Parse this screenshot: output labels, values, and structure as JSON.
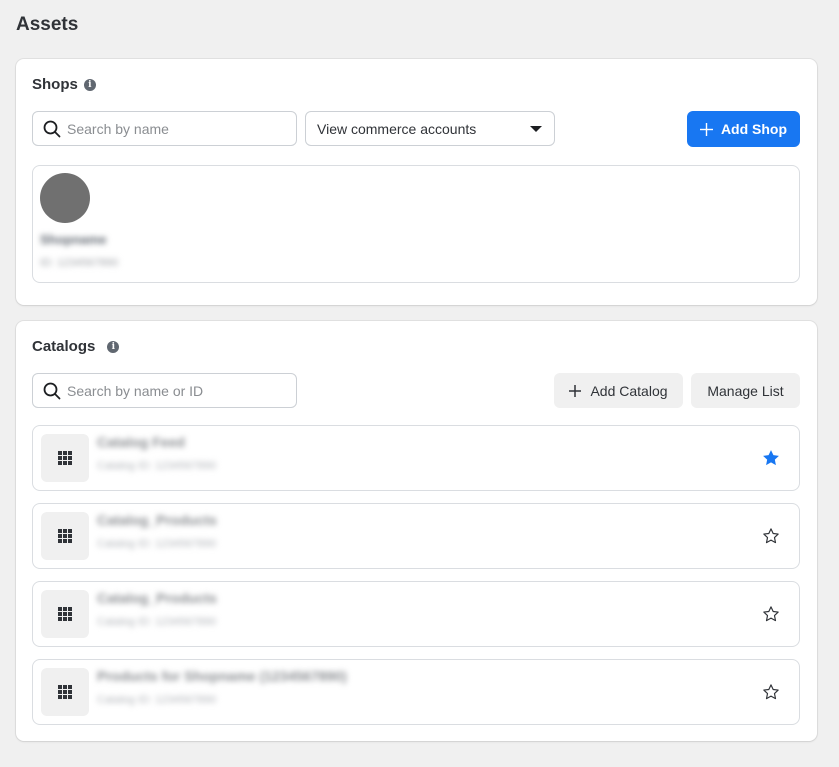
{
  "page": {
    "title": "Assets"
  },
  "shops": {
    "title": "Shops",
    "search_placeholder": "Search by name",
    "select_value": "View commerce accounts",
    "add_button": "Add Shop",
    "items": [
      {
        "name": "Shopname",
        "id": "ID: 1234567890"
      }
    ]
  },
  "catalogs": {
    "title": "Catalogs",
    "search_placeholder": "Search by name or ID",
    "add_button": "Add Catalog",
    "manage_button": "Manage List",
    "items": [
      {
        "name": "Catalog Feed",
        "id": "Catalog ID: 1234567890",
        "starred": true
      },
      {
        "name": "Catalog_Products",
        "id": "Catalog ID: 1234567890",
        "starred": false
      },
      {
        "name": "Catalog_Products",
        "id": "Catalog ID: 1234567890",
        "starred": false
      },
      {
        "name": "Products for Shopname (1234567890)",
        "id": "Catalog ID: 1234567890",
        "starred": false
      }
    ]
  },
  "colors": {
    "accent": "#1877f2",
    "page_bg": "#f0f0f0"
  }
}
